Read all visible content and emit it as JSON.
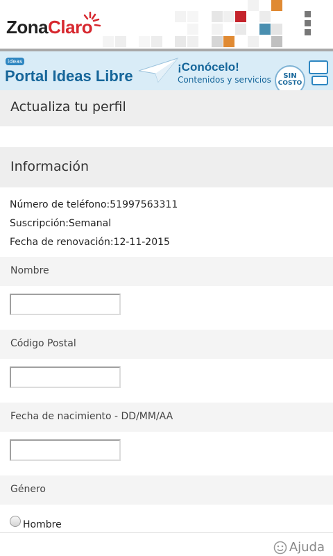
{
  "header": {
    "logo_zona": "Zona",
    "logo_claro": "Claro",
    "menu_icon": "vertical-dots-icon"
  },
  "banner": {
    "badge": "ideas",
    "title": "Portal Ideas Libre",
    "headline": "¡Conócelo!",
    "subtitle": "Contenidos y servicios",
    "sin": "SIN",
    "costo": "COSTO"
  },
  "page_title": "Actualiza tu perfil",
  "info": {
    "title": "Información",
    "phone": "Número de teléfono:51997563311",
    "subscription": "Suscripción:Semanal",
    "renewal": "Fecha de renovación:12-11-2015"
  },
  "fields": {
    "nombre": {
      "label": "Nombre",
      "value": ""
    },
    "codigo_postal": {
      "label": "Código Postal",
      "value": ""
    },
    "fecha_nacimiento": {
      "label": "Fecha de nacimiento - DD/MM/AA",
      "value": ""
    },
    "genero": {
      "label": "Género",
      "option_hombre": "Hombre"
    }
  },
  "footer": {
    "help_label": "Ajuda",
    "help_icon": "smiley-icon"
  }
}
